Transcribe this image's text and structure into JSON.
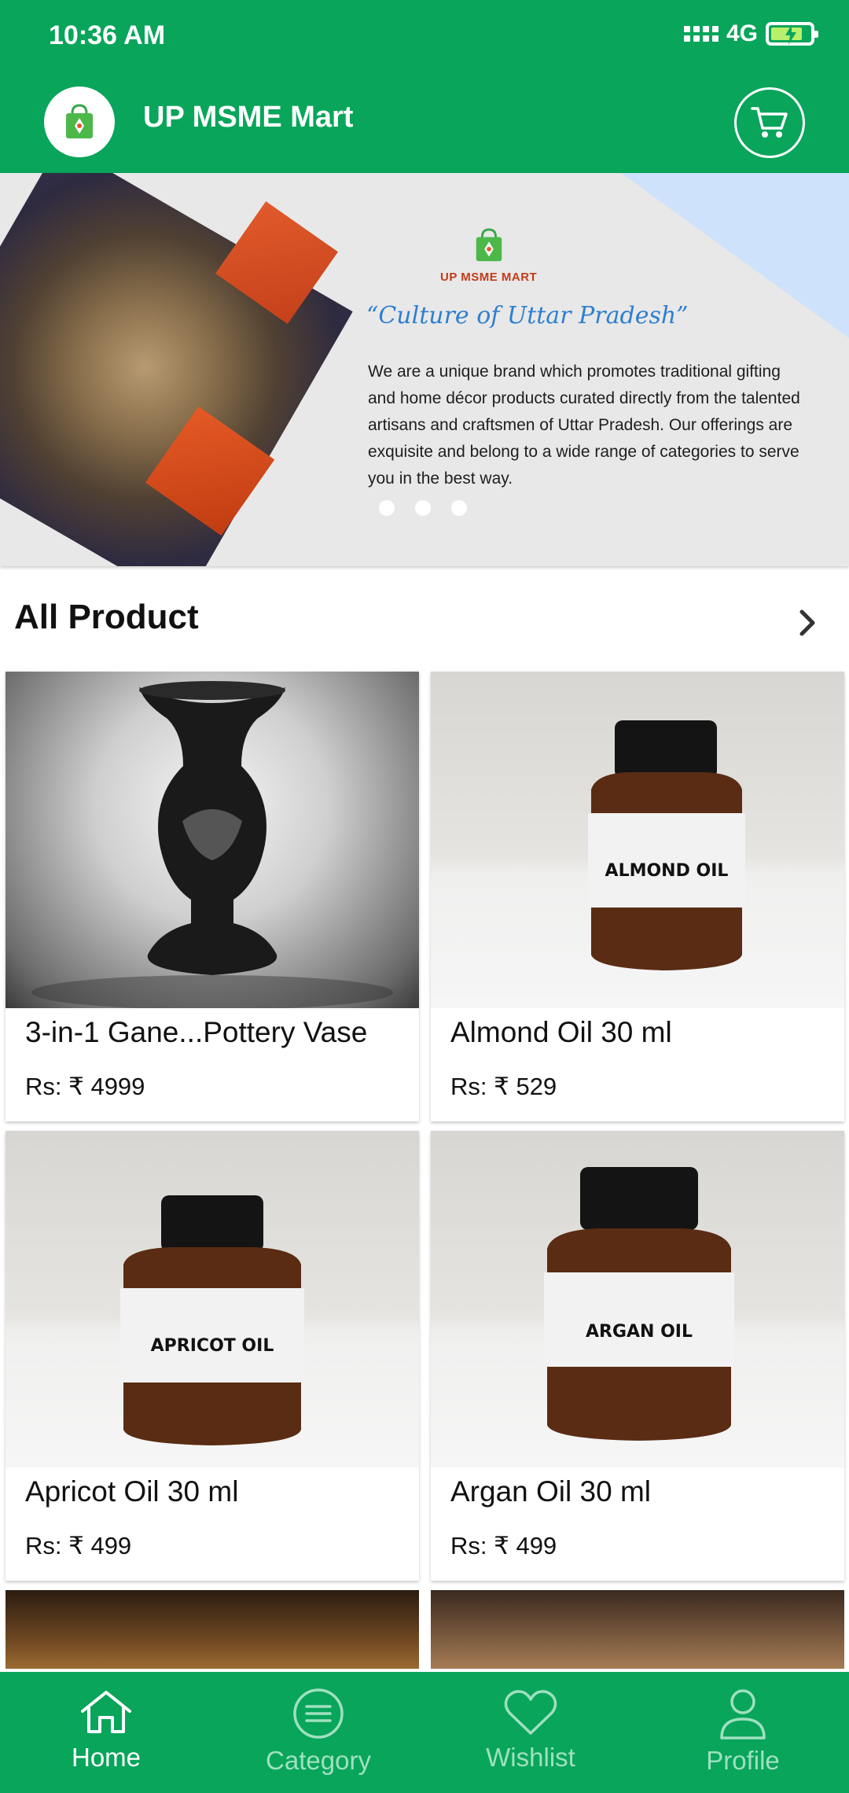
{
  "status_bar": {
    "time": "10:36 AM",
    "network": "4G"
  },
  "app_bar": {
    "title": "UP MSME Mart",
    "logo_icon": "shopping-bag-icon",
    "cart_icon": "cart-icon"
  },
  "banner": {
    "brand": "UP MSME MART",
    "tagline": "“Culture of Uttar Pradesh”",
    "description": "We are a unique brand which promotes traditional gifting and home décor products curated directly from the talented artisans and craftsmen of Uttar Pradesh. Our offerings are exquisite and belong to a wide range of categories to serve you in the best way.",
    "dots": 3
  },
  "section": {
    "title": "All Product"
  },
  "products": [
    {
      "name": "3-in-1 Gane...Pottery Vase",
      "price": "Rs: ₹ 4999",
      "image": "vase"
    },
    {
      "name": "Almond Oil 30 ml",
      "price": "Rs: ₹ 529",
      "image": "bottle",
      "label": "ALMOND OIL"
    },
    {
      "name": "Apricot Oil 30 ml",
      "price": "Rs: ₹ 499",
      "image": "bottle",
      "label": "APRICOT OIL"
    },
    {
      "name": "Argan Oil 30 ml",
      "price": "Rs: ₹ 499",
      "image": "bottle",
      "label": "ARGAN OIL"
    }
  ],
  "bottom_nav": [
    {
      "label": "Home",
      "icon": "home-icon",
      "active": true
    },
    {
      "label": "Category",
      "icon": "list-icon",
      "active": false
    },
    {
      "label": "Wishlist",
      "icon": "heart-icon",
      "active": false
    },
    {
      "label": "Profile",
      "icon": "user-icon",
      "active": false
    }
  ],
  "colors": {
    "primary": "#08a55b",
    "inactive_nav": "#9fe0bf",
    "tagline": "#2d7fd0",
    "brand_text": "#c13b1b"
  }
}
